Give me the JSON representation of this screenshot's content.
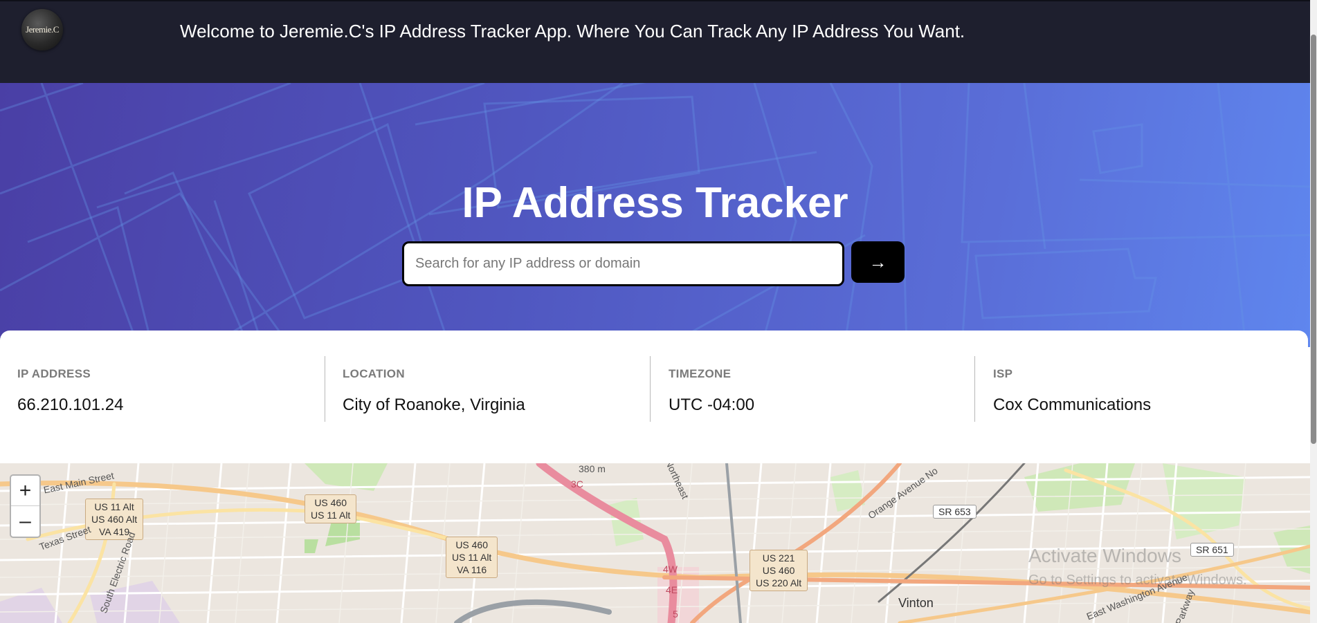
{
  "header": {
    "logo_text": "Jeremie.C",
    "welcome": "Welcome to Jeremie.C's IP Address Tracker App. Where You Can Track Any IP Address You Want."
  },
  "hero": {
    "title": "IP Address Tracker",
    "search_placeholder": "Search for any IP address or domain",
    "search_value": "",
    "submit_label": "→"
  },
  "info": [
    {
      "label": "IP ADDRESS",
      "value": "66.210.101.24"
    },
    {
      "label": "LOCATION",
      "value": "City of Roanoke, Virginia"
    },
    {
      "label": "TIMEZONE",
      "value": "UTC -04:00"
    },
    {
      "label": "ISP",
      "value": "Cox Communications"
    }
  ],
  "map": {
    "zoom_in": "+",
    "zoom_out": "–",
    "route_shields": [
      "US 11 Alt\nUS 460 Alt\nVA 419",
      "US 460\nUS 11 Alt",
      "US 460\nUS 11 Alt\nVA 116",
      "US 221\nUS 460\nUS 220 Alt"
    ],
    "state_routes": [
      "SR 653",
      "SR 651"
    ],
    "labels": {
      "east_main": "East Main Street",
      "texas": "Texas Street",
      "south_electric": "South Electric Road",
      "elevation": "380 m",
      "exit_3c": "3C",
      "exit_4w": "4W",
      "exit_4e": "4E",
      "exit_5": "5",
      "northeast": "Northeast",
      "orange_ave": "Orange Avenue No",
      "vinton": "Vinton",
      "east_washington": "East Washington Avenue",
      "parkway": "Parkway"
    },
    "watermark_title": "Activate Windows",
    "watermark_sub": "Go to Settings to activate Windows."
  },
  "colors": {
    "header_bg": "#1e1f2e",
    "hero_gradient_start": "#4a3fa5",
    "hero_gradient_end": "#5f86ee",
    "button_bg": "#000000"
  }
}
